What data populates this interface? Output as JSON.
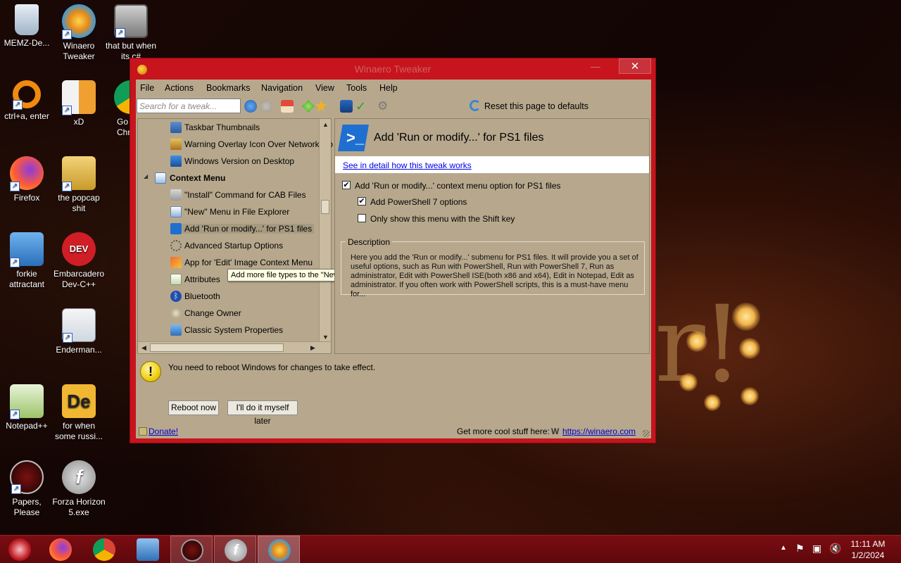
{
  "desktop": {
    "icons": [
      {
        "label": "MEMZ-De...",
        "icon": "recycle-bin-icon"
      },
      {
        "label": "Winaero Tweaker",
        "icon": "winaero-icon"
      },
      {
        "label": "that but when its c#",
        "icon": "folder-stack-icon"
      },
      {
        "label": "ctrl+a, enter",
        "icon": "ring-icon"
      },
      {
        "label": "xD",
        "icon": "hxd-icon"
      },
      {
        "label": "Go Chr",
        "icon": "chrome-icon"
      },
      {
        "label": "Firefox",
        "icon": "firefox-icon"
      },
      {
        "label": "the popcap shit",
        "icon": "popcap-folder-icon"
      },
      {
        "label": "forkie attractant",
        "icon": "gear-monitor-icon"
      },
      {
        "label": "Embarcadero Dev-C++",
        "icon": "devcpp-icon"
      },
      {
        "label": "Enderman...",
        "icon": "window-app-icon"
      },
      {
        "label": "Notepad++",
        "icon": "notepadpp-icon"
      },
      {
        "label": "for when some russi...",
        "icon": "de-icon"
      },
      {
        "label": "Papers, Please",
        "icon": "papers-please-icon"
      },
      {
        "label": "Forza Horizon 5.exe",
        "icon": "flash-icon"
      }
    ]
  },
  "window": {
    "title": "Winaero Tweaker",
    "close_label": "✕",
    "minimize_label": "—",
    "maximize_label": "□"
  },
  "menu": [
    "File",
    "Actions",
    "Bookmarks",
    "Navigation",
    "View",
    "Tools",
    "Help"
  ],
  "toolbar": {
    "search_placeholder": "Search for a tweak...",
    "reset_label": "Reset this page to defaults"
  },
  "tree": {
    "items": [
      {
        "label": "Taskbar Thumbnails",
        "icon": "taskbar-thumb-icon"
      },
      {
        "label": "Warning Overlay Icon Over Network Ico",
        "icon": "warning-overlay-icon"
      },
      {
        "label": "Windows Version on Desktop",
        "icon": "windows-version-icon"
      },
      {
        "label": "Context Menu",
        "icon": "context-menu-icon",
        "expander": "◢"
      },
      {
        "label": "\"Install\" Command for CAB Files",
        "icon": "cab-icon"
      },
      {
        "label": "\"New\" Menu in File Explorer",
        "icon": "new-menu-icon"
      },
      {
        "label": "Add 'Run or modify...' for PS1 files",
        "icon": "powershell-icon"
      },
      {
        "label": "Advanced Startup Options",
        "icon": "startup-icon"
      },
      {
        "label": "App for 'Edit' Image Context Menu",
        "icon": "image-edit-icon"
      },
      {
        "label": "Attributes",
        "icon": "attributes-icon"
      },
      {
        "label": "Bluetooth",
        "icon": "bluetooth-icon"
      },
      {
        "label": "Change Owner",
        "icon": "owner-icon"
      },
      {
        "label": "Classic System Properties",
        "icon": "system-props-icon"
      }
    ],
    "tooltip": "Add more file types to the \"New\" menu in File Explorer."
  },
  "detail": {
    "title": "Add 'Run or modify...' for PS1 files",
    "link": "See in detail how this tweak works",
    "options": [
      {
        "label": "Add 'Run or modify...' context menu option for PS1 files",
        "checked": true
      },
      {
        "label": "Add PowerShell 7 options",
        "checked": true
      },
      {
        "label": "Only show this menu with the Shift key",
        "checked": false
      }
    ],
    "description_legend": "Description",
    "description": "Here you add the 'Run or modify...' submenu for PS1 files. It will provide you a set of useful options, such as Run with PowerShell, Run with PowerShell 7, Run as administrator, Edit with PowerShell ISE(both x86 and x64), Edit in Notepad, Edit as administrator. If you often work with PowerShell scripts, this is a must-have menu for..."
  },
  "footer": {
    "reboot_notice": "You need to reboot Windows for changes to take effect.",
    "reboot_now": "Reboot now",
    "do_it_later": "I'll do it myself later",
    "donate": "Donate!",
    "get_more": "Get more cool stuff here:",
    "site": "https://winaero.com"
  },
  "taskbar": {
    "items": [
      "start-orb-icon",
      "firefox-icon",
      "chrome-icon",
      "control-panel-icon",
      "papers-please-icon",
      "flash-icon",
      "winaero-icon"
    ],
    "clock_time": "11:11 AM",
    "clock_date": "1/2/2024"
  },
  "colors": {
    "window_frame": "#c7141d",
    "client_bg": "#b7a88d",
    "taskbar": "#6e0a0f",
    "link": "#0000ee"
  }
}
